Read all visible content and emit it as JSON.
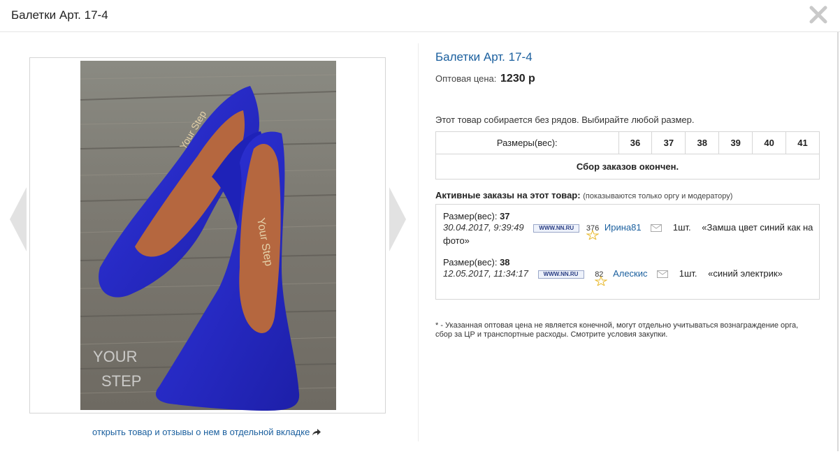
{
  "header": {
    "title": "Балетки Арт. 17-4"
  },
  "gallery": {
    "image_logo_lines": [
      "YOUR",
      "STEP"
    ],
    "open_link": "открыть товар и отзывы о нем в отдельной вкладке"
  },
  "product": {
    "title": "Балетки Арт. 17-4",
    "price_label": "Оптовая цена:",
    "price_value": "1230 р",
    "note": "Этот товар собирается без рядов. Выбирайте любой размер.",
    "sizes_label": "Размеры(вес):",
    "sizes": [
      "36",
      "37",
      "38",
      "39",
      "40",
      "41"
    ],
    "closed_text": "Сбор заказов окончен."
  },
  "active_orders": {
    "title": "Активные заказы на этот товар:",
    "subtitle": "(показываются только оргу и модератору)",
    "orders": [
      {
        "size_label": "Размер(вес):",
        "size": "37",
        "date": "30.04.2017, 9:39:49",
        "site": "WWW.NN.RU",
        "rating": "376",
        "user": "Ирина81",
        "qty": "1шт.",
        "comment_line1": "«Замша цвет синий как на",
        "comment_line2": "фото»"
      },
      {
        "size_label": "Размер(вес):",
        "size": "38",
        "date": "12.05.2017, 11:34:17",
        "site": "WWW.NN.RU",
        "rating": "82",
        "user": "Алескис",
        "qty": "1шт.",
        "comment_line1": "«синий электрик»",
        "comment_line2": ""
      }
    ]
  },
  "footnote": "* - Указанная оптовая цена не является конечной, могут отдельно учитываться вознаграждение орга, сбор за ЦР и транспортные расходы. Смотрите условия закупки.",
  "colors": {
    "link": "#1a5f9e",
    "shoe": "#2a2ed0",
    "insole": "#b5673f"
  }
}
